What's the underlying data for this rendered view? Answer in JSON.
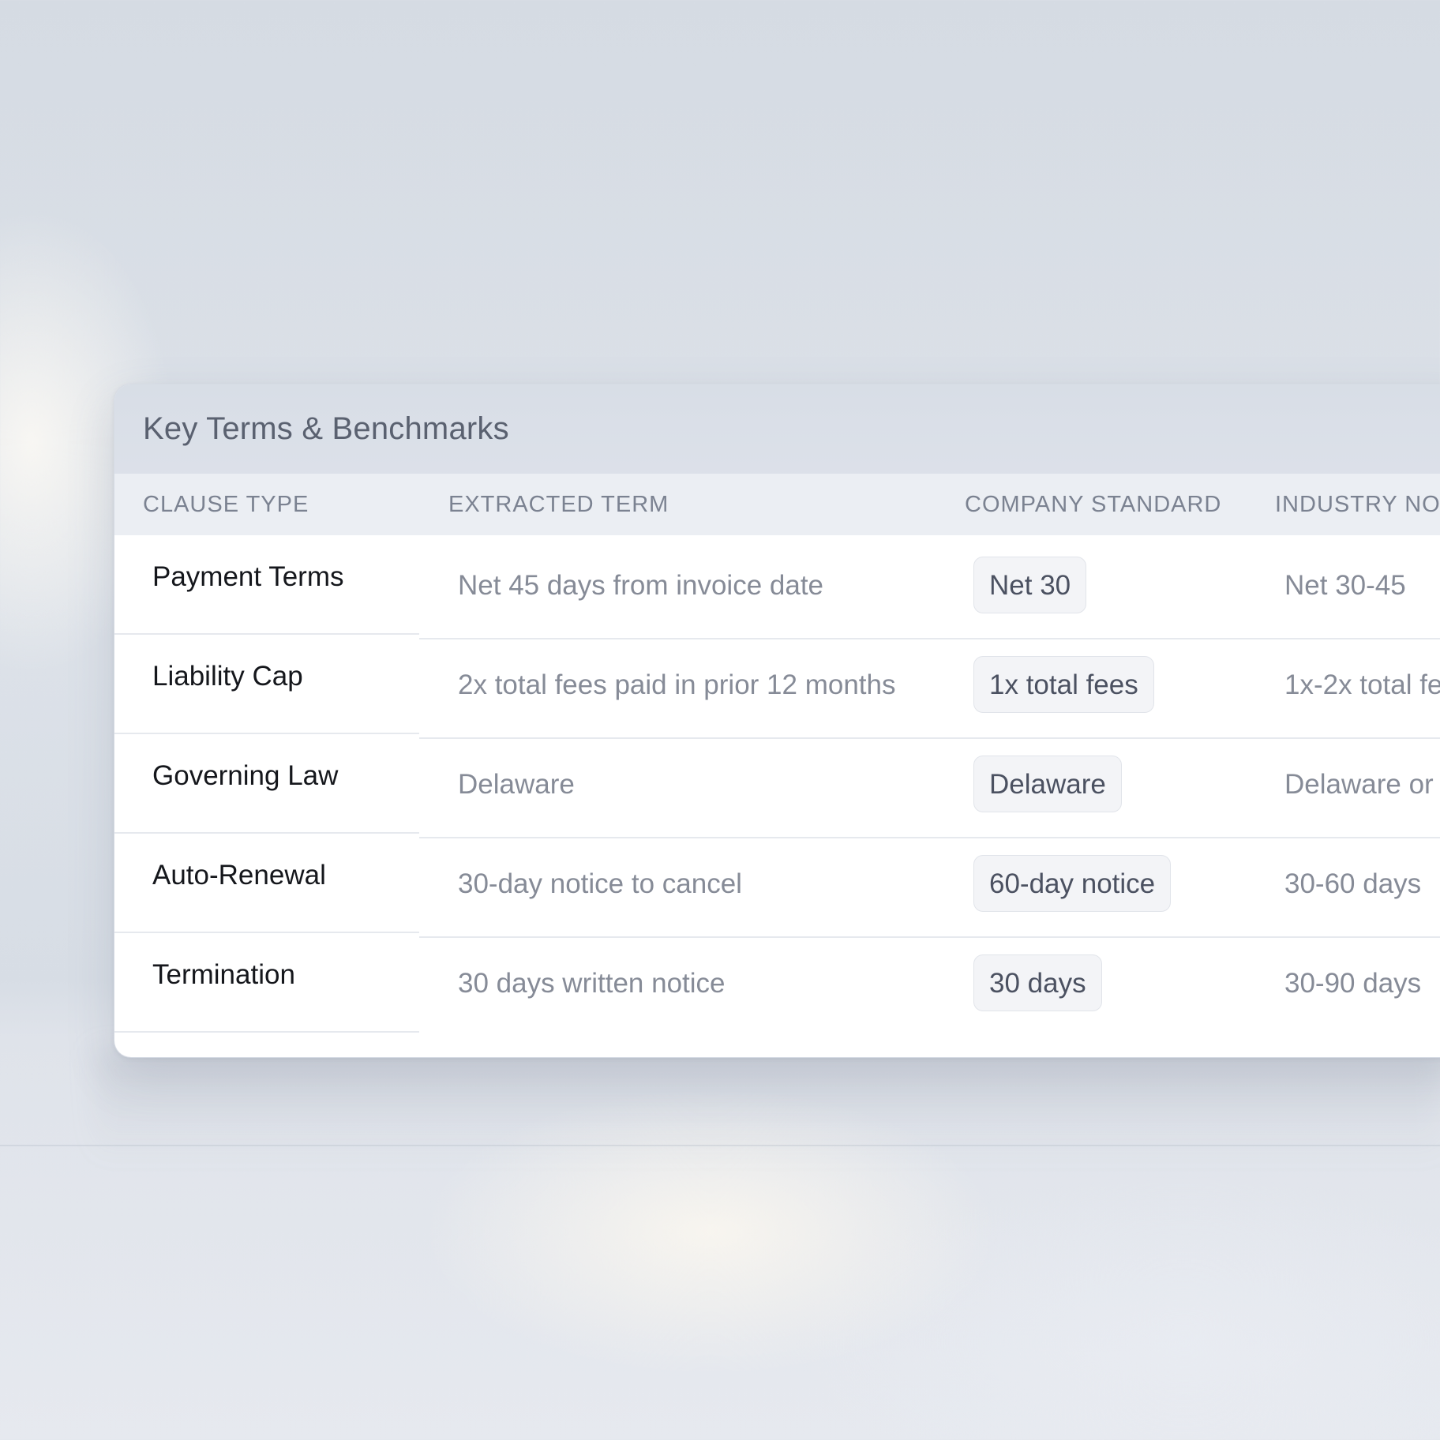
{
  "card": {
    "title": "Key Terms & Benchmarks"
  },
  "table": {
    "headers": {
      "clause_type": "CLAUSE TYPE",
      "extracted_term": "EXTRACTED TERM",
      "company_standard": "COMPANY STANDARD",
      "industry_norm": "INDUSTRY NO"
    },
    "rows": [
      {
        "clause": "Payment Terms",
        "extracted": "Net 45 days from invoice date",
        "standard": "Net 30",
        "industry": "Net 30-45"
      },
      {
        "clause": "Liability Cap",
        "extracted": "2x total fees paid in prior 12 months",
        "standard": "1x total fees",
        "industry": "1x-2x total fe"
      },
      {
        "clause": "Governing Law",
        "extracted": "Delaware",
        "standard": "Delaware",
        "industry": "Delaware or"
      },
      {
        "clause": "Auto-Renewal",
        "extracted": "30-day notice to cancel",
        "standard": "60-day notice",
        "industry": "30-60 days"
      },
      {
        "clause": "Termination",
        "extracted": "30 days written notice",
        "standard": "30 days",
        "industry": "30-90 days"
      }
    ]
  },
  "colors": {
    "header_bg": "#d8dde6",
    "table_head_bg": "#ebeef3",
    "pill_bg": "#f3f4f7",
    "clause_text": "#15171c",
    "muted_text": "#868b97"
  }
}
